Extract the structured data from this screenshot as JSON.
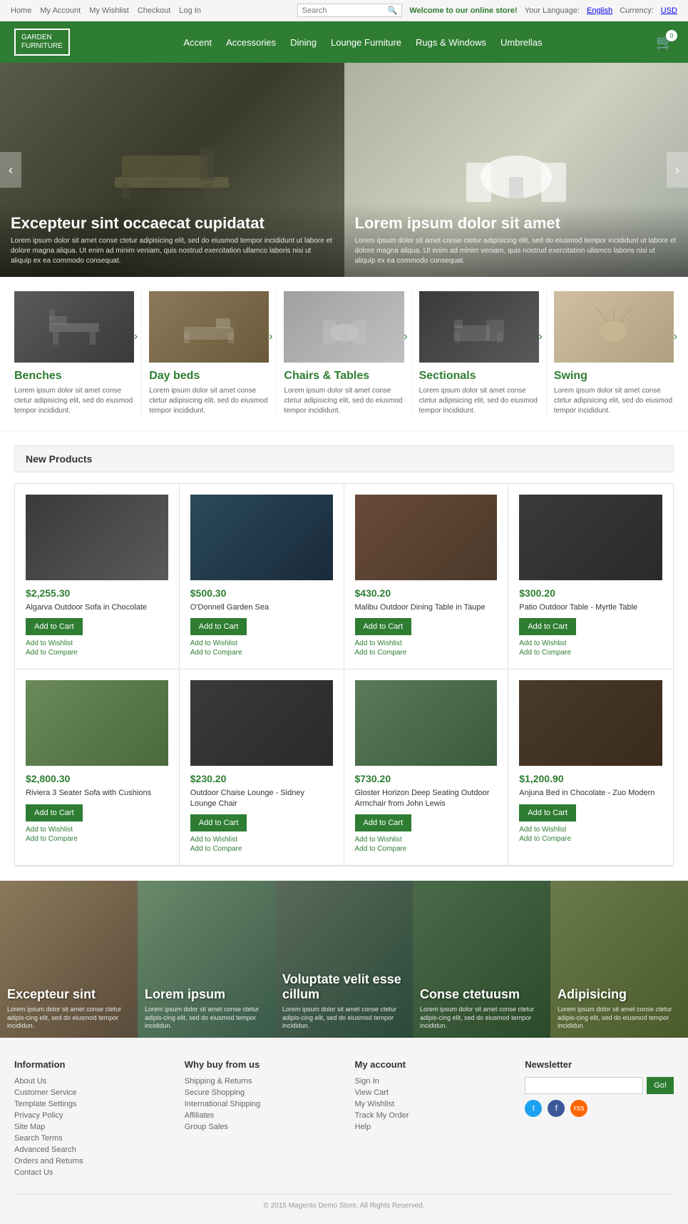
{
  "topbar": {
    "links": [
      "Home",
      "My Account",
      "My Wishlist",
      "Checkout",
      "Log In"
    ],
    "search_placeholder": "Search",
    "welcome": "Welcome to our online store!",
    "language_label": "Your Language:",
    "language_value": "English",
    "currency_label": "Currency:",
    "currency_value": "USD"
  },
  "header": {
    "logo_line1": "GARDEN",
    "logo_line2": "FURNITURE",
    "nav_items": [
      "Accent",
      "Accessories",
      "Dining",
      "Lounge Furniture",
      "Rugs & Windows",
      "Umbrellas"
    ],
    "cart_count": "0"
  },
  "hero": {
    "left": {
      "title": "Excepteur sint occaecat cupidatat",
      "desc": "Lorem ipsum dolor sit amet conse ctetur adipisicing elit, sed do eiusmod tempor incididunt ut labore et dolore magna aliqua. Ut enim ad minim veniam, quis nostrud exercitation ullamco laboris nisi ut aliquip ex ea commodo consequat."
    },
    "right": {
      "title": "Lorem ipsum dolor sit amet",
      "desc": "Lorem ipsum dolor sit amet conse ctetur adipisicing elit, sed do eiusmod tempor incididunt ut labore et dolore magna aliqua. Ut enim ad minim veniam, quis nostrud exercitation ullamco laboris nisi ut aliquip ex ea commodo consequat."
    }
  },
  "categories": [
    {
      "title": "Benches",
      "desc": "Lorem ipsum dolor sit amet conse ctetur adipisicing elit, sed do eiusmod tempor incididunt."
    },
    {
      "title": "Day beds",
      "desc": "Lorem ipsum dolor sit amet conse ctetur adipisicing elit, sed do eiusmod tempor incididunt."
    },
    {
      "title": "Chairs & Tables",
      "desc": "Lorem ipsum dolor sit amet conse ctetur adipisicing elit, sed do eiusmod tempor incididunt."
    },
    {
      "title": "Sectionals",
      "desc": "Lorem ipsum dolor sit amet conse ctetur adipisicing elit, sed do eiusmod tempor incididunt."
    },
    {
      "title": "Swing",
      "desc": "Lorem ipsum dolor sit amet conse ctetur adipisicing elit, sed do eiusmod tempor incididunt."
    }
  ],
  "new_products": {
    "section_title": "New Products",
    "products": [
      {
        "price": "$2,255.30",
        "name": "Algarva Outdoor Sofa in Chocolate",
        "add_to_cart": "Add to Cart",
        "wishlist": "Add to Wishlist",
        "compare": "Add to Compare",
        "img_class": "sofa-img"
      },
      {
        "price": "$500.30",
        "name": "O'Donnell Garden Sea",
        "add_to_cart": "Add to Cart",
        "wishlist": "Add to Wishlist",
        "compare": "Add to Compare",
        "img_class": "stool-img"
      },
      {
        "price": "$430.20",
        "name": "Malibu Outdoor Dining Table in Taupe",
        "add_to_cart": "Add to Cart",
        "wishlist": "Add to Wishlist",
        "compare": "Add to Compare",
        "img_class": "table-img"
      },
      {
        "price": "$300.20",
        "name": "Patio Outdoor Table - Myrtle Table",
        "add_to_cart": "Add to Cart",
        "wishlist": "Add to Wishlist",
        "compare": "Add to Compare",
        "img_class": "ptable-img"
      },
      {
        "price": "$2,800.30",
        "name": "Riviera 3 Seater Sofa with Cushions",
        "add_to_cart": "Add to Cart",
        "wishlist": "Add to Wishlist",
        "compare": "Add to Compare",
        "img_class": "sofa2-img"
      },
      {
        "price": "$230.20",
        "name": "Outdoor Chaise Lounge - Sidney Lounge Chair",
        "add_to_cart": "Add to Cart",
        "wishlist": "Add to Wishlist",
        "compare": "Add to Compare",
        "img_class": "chaise-img"
      },
      {
        "price": "$730.20",
        "name": "Gloster Horizon Deep Seating Outdoor Armchair from John Lewis",
        "add_to_cart": "Add to Cart",
        "wishlist": "Add to Wishlist",
        "compare": "Add to Compare",
        "img_class": "armchair-img"
      },
      {
        "price": "$1,200.90",
        "name": "Anjuna Bed in Chocolate - Zuo Modern",
        "add_to_cart": "Add to Cart",
        "wishlist": "Add to Wishlist",
        "compare": "Add to Compare",
        "img_class": "bed-img"
      }
    ]
  },
  "banners": [
    {
      "title": "Excepteur sint",
      "desc": "Lorem ipsum dolor sit amet conse ctetur adipis-cing elit, sed do eiusmod tempor incididun."
    },
    {
      "title": "Lorem ipsum",
      "desc": "Lorem ipsum dolor sit amet conse ctetur adipis-cing elit, sed do eiusmod tempor incididun."
    },
    {
      "title": "Voluptate velit esse cillum",
      "desc": "Lorem ipsum dolor sit amet conse ctetur adipis-cing elit, sed do eiusmod tempor incididun."
    },
    {
      "title": "Conse ctetuusm",
      "desc": "Lorem ipsum dolor sit amet conse ctetur adipis-cing elit, sed do eiusmod tempor incididun."
    },
    {
      "title": "Adipisicing",
      "desc": "Lorem ipsum dolor sit amet conse ctetur adipis-cing elit, sed do eiusmod tempor incididun."
    }
  ],
  "footer": {
    "information": {
      "title": "Information",
      "links": [
        "About Us",
        "Customer Service",
        "Template Settings",
        "Privacy Policy",
        "Site Map",
        "Search Terms",
        "Advanced Search",
        "Orders and Returns",
        "Contact Us"
      ]
    },
    "why_buy": {
      "title": "Why buy from us",
      "links": [
        "Shipping & Returns",
        "Secure Shopping",
        "International Shipping",
        "Affiliates",
        "Group Sales"
      ]
    },
    "my_account": {
      "title": "My account",
      "links": [
        "Sign In",
        "View Cart",
        "My Wishlist",
        "Track My Order",
        "Help"
      ]
    },
    "newsletter": {
      "title": "Newsletter",
      "go_button": "Go!"
    },
    "social": [
      "t",
      "f",
      "rss"
    ],
    "copyright": "© 2015 Magento Demo Store. All Rights Reserved."
  }
}
